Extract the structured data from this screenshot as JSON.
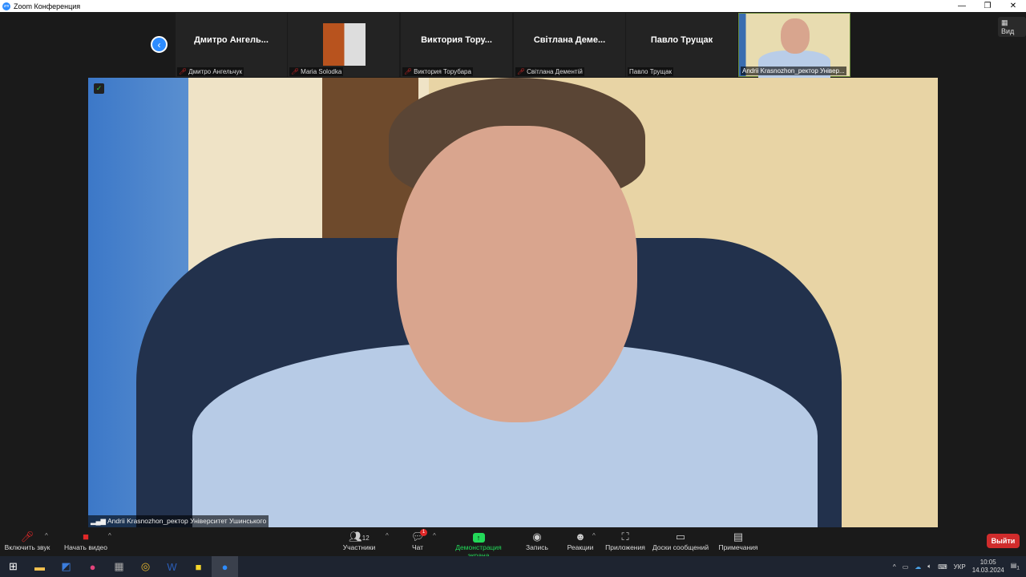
{
  "window": {
    "title": "Zoom Конференция",
    "minimize": "—",
    "maximize": "❐",
    "close": "✕"
  },
  "gallery": {
    "view_label": "Вид",
    "tiles": [
      {
        "big_name": "Дмитро  Ангель...",
        "name": "Дмитро Ангельчук",
        "muted": true
      },
      {
        "big_name": "",
        "name": "Maria Solodka",
        "muted": true
      },
      {
        "big_name": "Виктория  Тору...",
        "name": "Виктория Торубара",
        "muted": true
      },
      {
        "big_name": "Світлана  Деме...",
        "name": "Світлана Дементій",
        "muted": true
      },
      {
        "big_name": "Павло Трущак",
        "name": "Павло Трущак",
        "muted": false
      }
    ],
    "self_name": "Andrii Krasnozhon_ректор Універ..."
  },
  "main_video": {
    "speaker_name": "Andrii Krasnozhon_ректор Університет Ушинського"
  },
  "toolbar": {
    "unmute": "Включить звук",
    "start_video": "Начать видео",
    "participants": "Участники",
    "participants_count": "12",
    "chat": "Чат",
    "chat_badge": "1",
    "share": "Демонстрация экрана",
    "record": "Запись",
    "reactions": "Реакции",
    "apps": "Приложения",
    "whiteboards": "Доски сообщений",
    "notes": "Примечания",
    "leave": "Выйти"
  },
  "taskbar": {
    "lang": "УКР",
    "time": "10:05",
    "date": "14.03.2024",
    "notif_count": "1"
  },
  "colors": {
    "accent": "#2d8cff",
    "share": "#23d959",
    "leave": "#d02c2c"
  }
}
